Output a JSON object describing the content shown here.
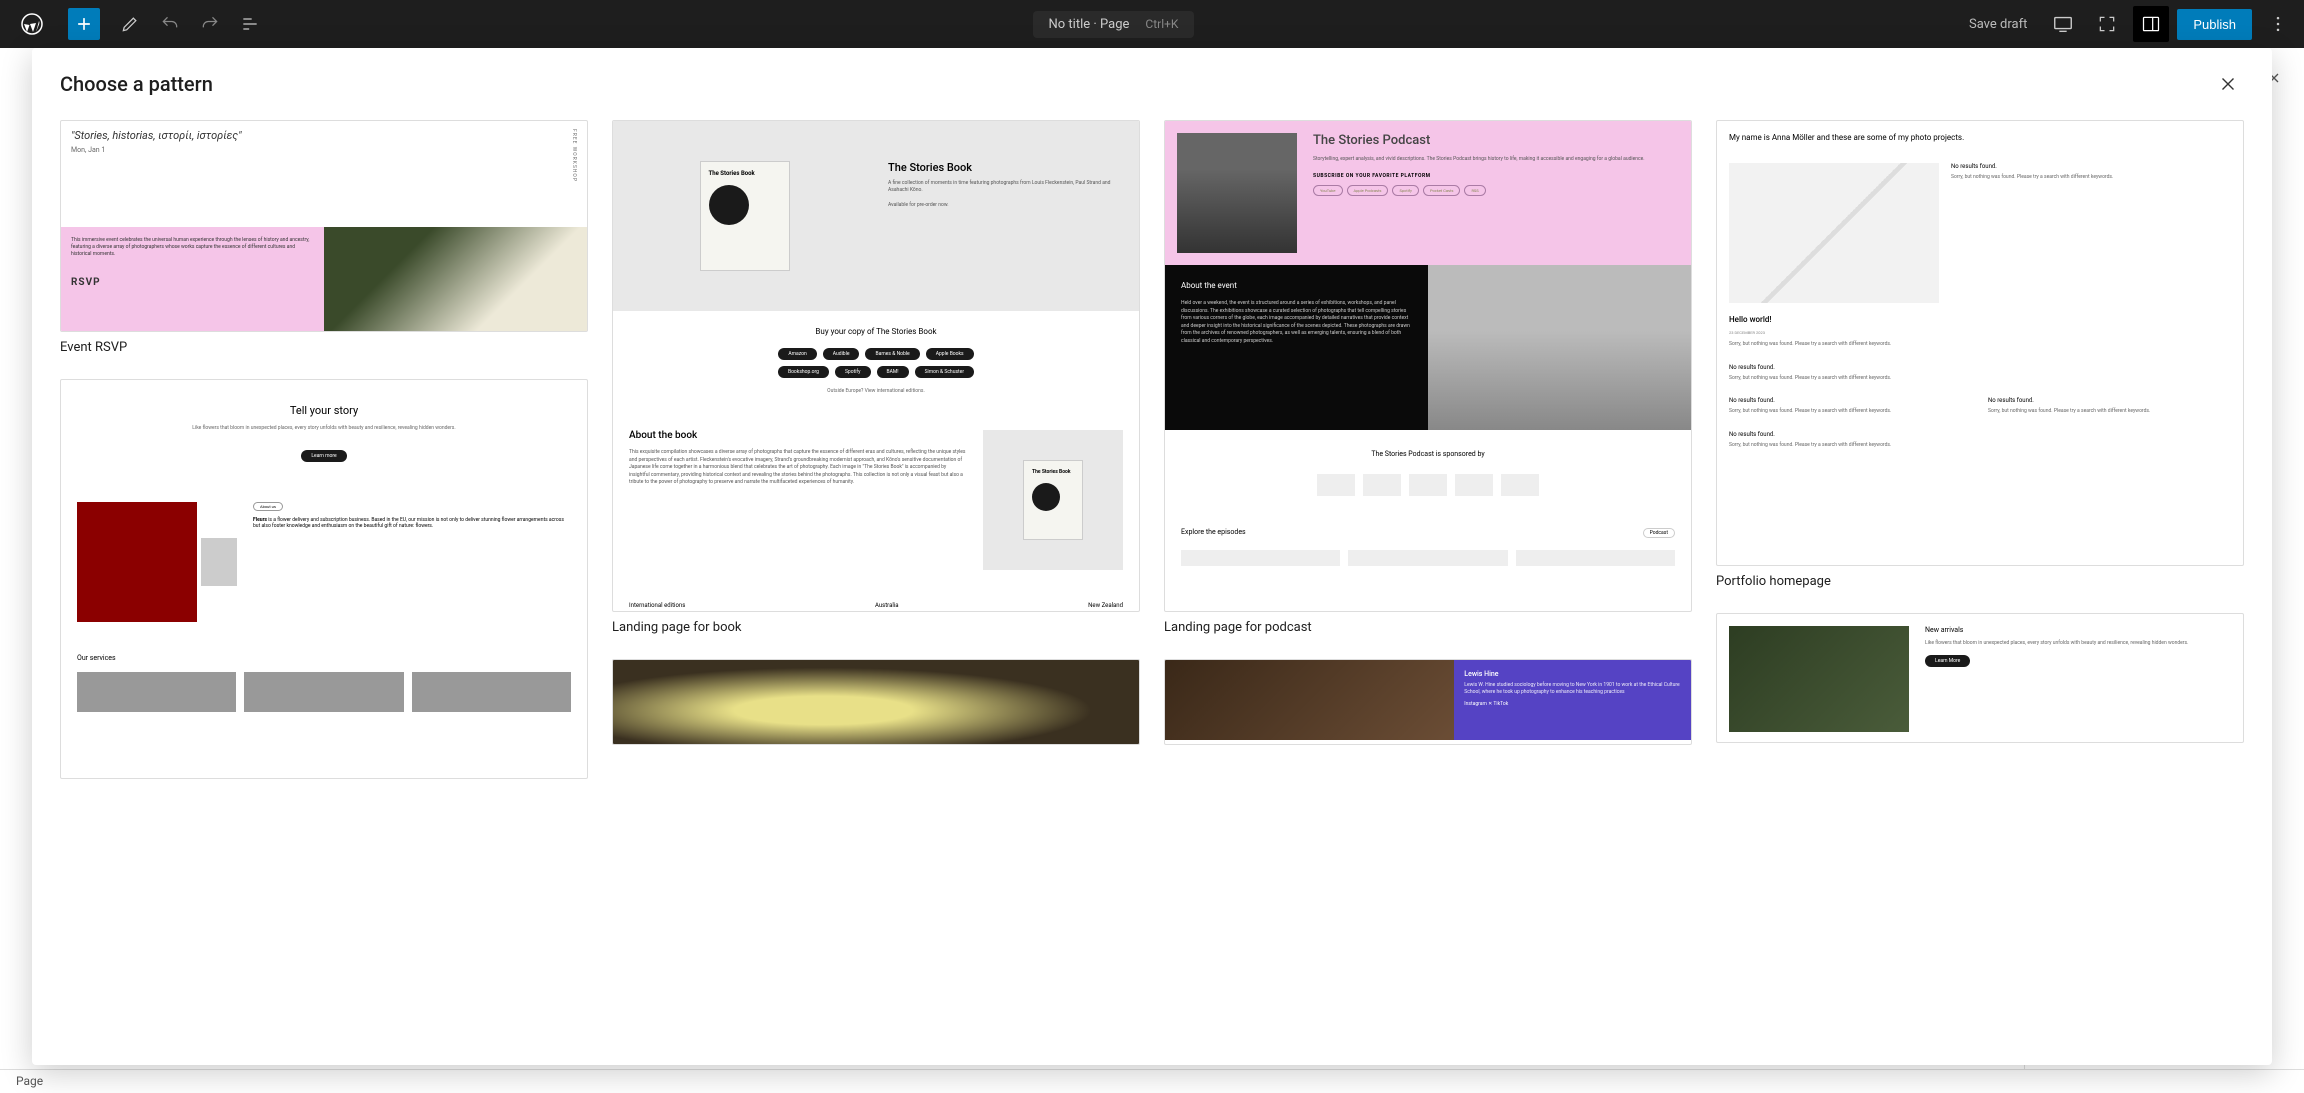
{
  "topbar": {
    "page_title": "No title · Page",
    "shortcut": "Ctrl+K",
    "save_draft": "Save draft",
    "publish": "Publish"
  },
  "modal": {
    "title": "Choose a pattern"
  },
  "patterns": {
    "p1": {
      "label": "Event RSVP",
      "quote": "\"Stories, historias, ιστορίι, iστορίες\"",
      "date": "Mon, Jan 1",
      "vertical": "FREE WORKSHOP",
      "body": "This immersive event celebrates the universal human experience through the lenses of history and ancestry, featuring a diverse array of photographers whose works capture the essence of different cultures and historical moments.",
      "rsvp": "RSVP"
    },
    "p2": {
      "label": "Landing page for book",
      "book_label": "The Stories Book",
      "title": "The Stories Book",
      "desc": "A fine collection of moments in time featuring photographs from Louis Fleckenstein, Paul Strand and Asahachi Kōno.",
      "avail": "Available for pre-order now.",
      "buy_title": "Buy your copy of The Stories Book",
      "pills_row1": [
        "Amazon",
        "Audible",
        "Barnes & Noble",
        "Apple Books"
      ],
      "pills_row2": [
        "Bookshop.org",
        "Spotify",
        "BAM!",
        "Simon & Schuster"
      ],
      "outside": "Outside Europe? View international editions.",
      "about_title": "About the book",
      "about_desc": "This exquisite compilation showcases a diverse array of photographs that capture the essence of different eras and cultures, reflecting the unique styles and perspectives of each artist. Fleckenstein's evocative imagery, Strand's groundbreaking modernist approach, and Kōno's sensitive documentation of Japanese life come together in a harmonious blend that celebrates the art of photography. Each image in \"The Stories Book\" is accompanied by insightful commentary, providing historical context and revealing the stories behind the photographs. This collection is not only a visual feast but also a tribute to the power of photography to preserve and narrate the multifaceted experiences of humanity.",
      "intl_label": "International editions",
      "intl_au": "Australia",
      "intl_nz": "New Zealand"
    },
    "p3": {
      "label": "Landing page for podcast",
      "title": "The Stories Podcast",
      "desc": "Storytelling, expert analysis, and vivid descriptions. The Stories Podcast brings history to life, making it accessible and engaging for a global audience.",
      "subscribe": "SUBSCRIBE ON YOUR FAVORITE PLATFORM",
      "pills": [
        "YouTube",
        "Apple Podcasts",
        "Spotify",
        "Pocket Casts",
        "RSS"
      ],
      "event_title": "About the event",
      "event_desc": "Held over a weekend, the event is structured around a series of exhibitions, workshops, and panel discussions. The exhibitions showcase a curated selection of photographs that tell compelling stories from various corners of the globe, each image accompanied by detailed narratives that provide context and deeper insight into the historical significance of the scenes depicted. These photographs are drawn from the archives of renowned photographers, as well as emerging talents, ensuring a blend of both classical and contemporary perspectives.",
      "sponsor_title": "The Stories Podcast is sponsored by",
      "explore": "Explore the episodes",
      "explore_tag": "Podcast"
    },
    "p4": {
      "label": "Portfolio homepage",
      "intro": "My name is Anna Möller and these are some of my photo projects.",
      "noresults": "No results found.",
      "sorry": "Sorry, but nothing was found. Please try a search with different keywords.",
      "hello": "Hello world!",
      "hello_date": "23 DECEMBER 2023"
    },
    "p5": {
      "title": "Tell your story",
      "desc": "Like flowers that bloom in unexpected places, every story unfolds with beauty and resilience, revealing hidden wonders.",
      "learn": "Learn more",
      "about": "About us",
      "fleurs": "Fleurs",
      "fleurs_desc": " is a flower delivery and subscription business. Based in the EU, our mission is not only to deliver stunning flower arrangements across but also foster knowledge and enthusiasm on the beautiful gift of nature: flowers.",
      "services": "Our services"
    },
    "p6": {
      "name": "Lewis Hine",
      "desc": "Lewis W. Hine studied sociology before moving to New York in 1901 to work at the Ethical Culture School, where he took up photography to enhance his teaching practices",
      "social": "Instagram ✕ TikTok"
    },
    "p8": {
      "title": "New arrivals",
      "desc": "Like flowers that bloom in unexpected places, every story unfolds with beauty and resilience, revealing hidden wonders.",
      "btn": "Learn More"
    }
  },
  "bottom": {
    "label": "Page"
  }
}
